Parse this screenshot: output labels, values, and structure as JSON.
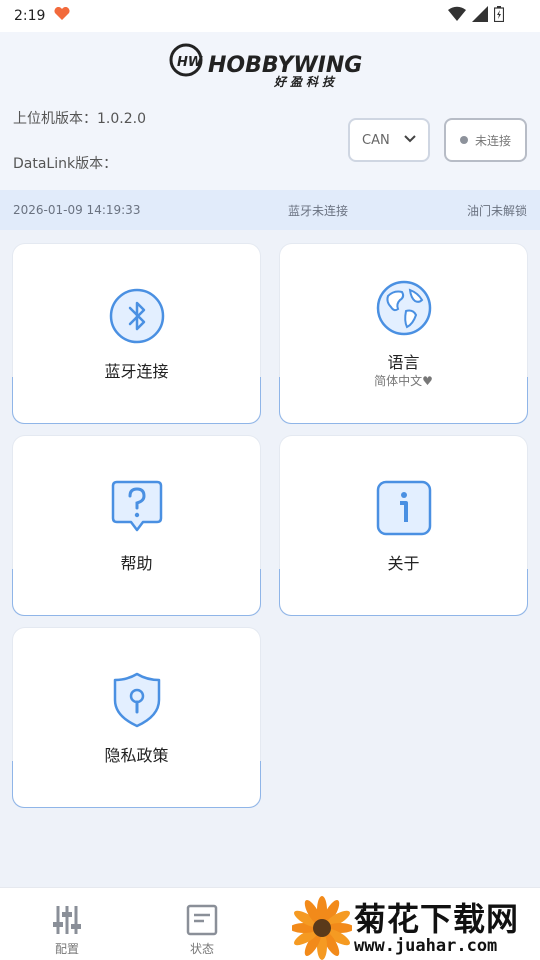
{
  "status_bar": {
    "time": "2:19"
  },
  "header": {
    "brand_name": "HOBBYWING",
    "brand_cn": "好盈科技",
    "host_version": "上位机版本：1.0.2.0",
    "datalink_version": "DataLink版本：",
    "protocol_select": "CAN",
    "connect_button": "未连接"
  },
  "info_bar": {
    "datetime": "2026-01-09 14:19:33",
    "bluetooth_status": "蓝牙未连接",
    "throttle_status": "油门未解锁"
  },
  "cards": {
    "bluetooth": {
      "label": "蓝牙连接",
      "icon": "bluetooth-icon"
    },
    "language": {
      "label": "语言",
      "sub": "简体中文♥",
      "icon": "globe-icon"
    },
    "help": {
      "label": "帮助",
      "icon": "question-bubble-icon"
    },
    "about": {
      "label": "关于",
      "icon": "info-icon"
    },
    "privacy": {
      "label": "隐私政策",
      "icon": "shield-keyhole-icon"
    }
  },
  "bottom_nav": {
    "config": "配置",
    "status": "状态"
  },
  "watermark": {
    "title": "菊花下载网",
    "url": "www.juahar.com"
  },
  "colors": {
    "accent": "#4a90e2",
    "icon_fill": "#e3efff",
    "card_border": "#8fb5e8",
    "info_bar": "#e1ebfa"
  }
}
